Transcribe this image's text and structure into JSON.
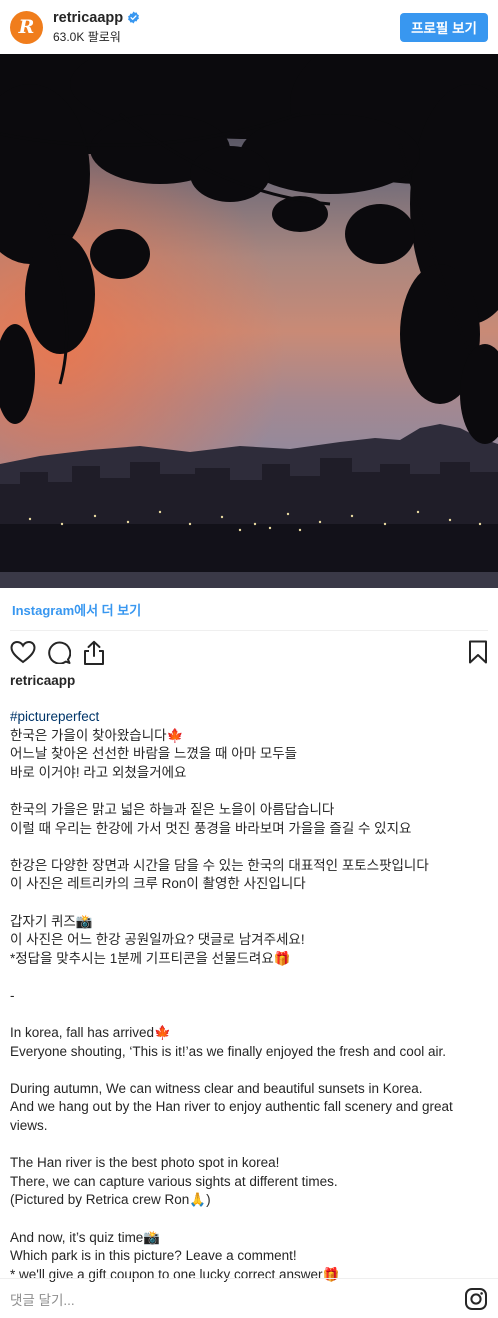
{
  "header": {
    "avatar_letter": "R",
    "username": "retricaapp",
    "followers": "63.0K 팔로워",
    "profile_button": "프로필 보기"
  },
  "post": {
    "view_more": "Instagram에서 더 보기",
    "poster": "retricaapp"
  },
  "caption": {
    "hashtag": "#pictureperfect",
    "ko_p1": [
      "한국은 가을이 찾아왔습니다🍁",
      "어느날 찾아온 선선한 바람을 느꼈을 때 아마 모두들",
      "바로 이거야! 라고 외쳤을거에요"
    ],
    "ko_p2": [
      "한국의 가을은 맑고 넓은 하늘과 짙은 노을이 아름답습니다",
      "이럴 때 우리는 한강에 가서 멋진 풍경을 바라보며 가을을 즐길 수 있지요"
    ],
    "ko_p3": [
      "한강은 다양한 장면과 시간을 담을 수 있는 한국의 대표적인 포토스팟입니다",
      "이 사진은 레트리카의 크루 Ron이 촬영한 사진입니다"
    ],
    "ko_p4": [
      "갑자기 퀴즈📸",
      "이 사진은 어느 한강 공원일까요? 댓글로 남겨주세요!",
      "*정답을 맞추시는 1분께 기프티콘을 선물드려요🎁"
    ],
    "separator": "-",
    "en_p1": [
      "In korea, fall has arrived🍁",
      "Everyone shouting, ‘This is it!’as we finally enjoyed the fresh and cool air."
    ],
    "en_p2": [
      "During autumn, We can witness clear and beautiful sunsets in Korea.",
      "And we hang out by the Han river to enjoy authentic fall scenery and great",
      "views."
    ],
    "en_p3": [
      "The Han river is the best photo spot in korea!",
      "There, we can capture various sights at different times.",
      "(Pictured by Retrica crew Ron🙏)"
    ],
    "en_p4": [
      "And now, it’s quiz time📸",
      "Which park is in this picture? Leave a comment!",
      "* we'll give a gift coupon to one lucky correct answer🎁"
    ]
  },
  "comment": {
    "placeholder": "댓글 달기..."
  },
  "icons": {
    "verified": "verified-badge-icon",
    "like": "heart-icon",
    "comment": "comment-bubble-icon",
    "share": "share-icon",
    "save": "bookmark-icon",
    "instagram": "instagram-logo-icon"
  },
  "colors": {
    "accent": "#3897f0",
    "avatar": "#f07d1c",
    "hashtag": "#003569"
  }
}
